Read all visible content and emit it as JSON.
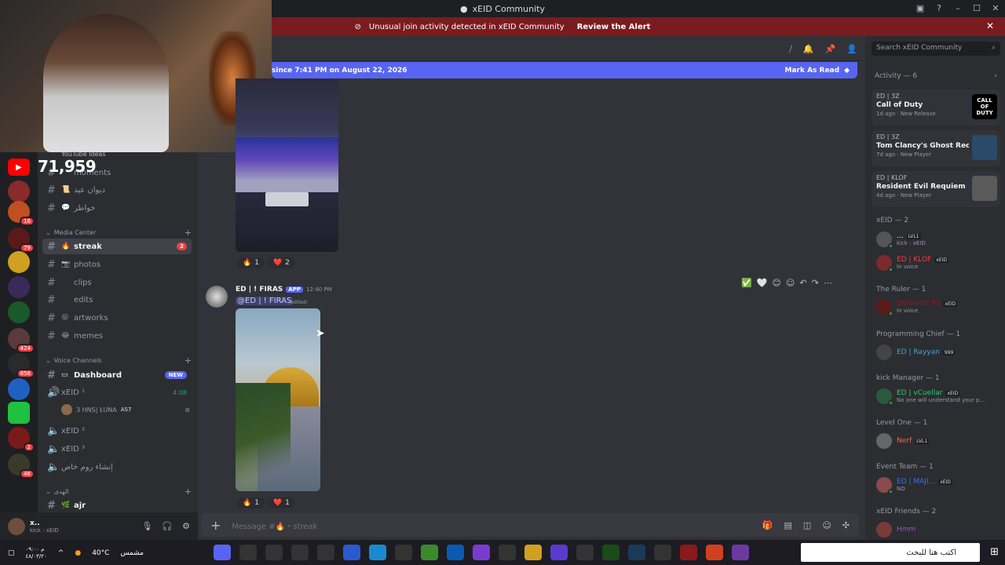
{
  "window": {
    "title": "xEID Community"
  },
  "alert": {
    "text": "Unusual join activity detected in xEID Community",
    "action": "Review the Alert"
  },
  "stream_overlay": {
    "label": "YouTube Ideas",
    "count": "71,959"
  },
  "channels": {
    "items_top": [
      {
        "emoji": "",
        "label": "moments"
      },
      {
        "emoji": "📜",
        "label": "ديوان عيد"
      },
      {
        "emoji": "💬",
        "label": "خواطر"
      }
    ],
    "media_category": "Media Center",
    "media_items": [
      {
        "emoji": "🔥",
        "label": "streak",
        "badge": "2",
        "active": true
      },
      {
        "emoji": "📷",
        "label": "photos"
      },
      {
        "emoji": "",
        "label": "clips"
      },
      {
        "emoji": "",
        "label": "edits"
      },
      {
        "emoji": "😝",
        "label": "artworks"
      },
      {
        "emoji": "😂",
        "label": "memes"
      }
    ],
    "voice_category": "Voice Channels",
    "dashboard": {
      "label": "Dashboard",
      "tag": "NEW"
    },
    "voice_items": [
      {
        "label": "xEID ¹",
        "time": "4:08"
      },
      {
        "label": "xEID ²"
      },
      {
        "label": "xEID ³"
      },
      {
        "label": "إنشاء روم خاص"
      }
    ],
    "voice_user": {
      "name": "3 HNS| ŁUNA",
      "tag": "AS7"
    },
    "bottom_category": "الهدى",
    "bottom_item": "ajr"
  },
  "user_panel": {
    "name": "x..",
    "status": "kick : xEID"
  },
  "new_messages_bar": {
    "text": "since 7:41 PM on August 22, 2026",
    "action": "Mark As Read"
  },
  "message1": {
    "reactions": [
      {
        "emoji": "🔥",
        "count": "1"
      },
      {
        "emoji": "❤️",
        "count": "2"
      }
    ]
  },
  "message2": {
    "author": "ED | ! FIRAS",
    "tag": "APP",
    "time": "12:40 PM",
    "mention": "@ED | ! FIRAS",
    "edited": "(edited)",
    "reactions": [
      {
        "emoji": "🔥",
        "count": "1"
      },
      {
        "emoji": "❤️",
        "count": "1"
      }
    ]
  },
  "composer": {
    "placeholder": "Message #🔥・streak"
  },
  "right": {
    "search_placeholder": "Search xEID Community",
    "activity_header": "Activity — 6",
    "activities": [
      {
        "who": "ED | 3Z",
        "game": "Call of Duty",
        "meta": "1d ago · New Release",
        "thumb": "CALL OF DUTY"
      },
      {
        "who": "ED | 3Z",
        "game": "Tom Clancy's Ghost Recon ...",
        "meta": "7d ago · New Player",
        "thumb": ""
      },
      {
        "who": "ED | KLOF",
        "game": "Resident Evil Requiem",
        "meta": "4d ago · New Player",
        "thumb": ""
      }
    ],
    "groups": [
      {
        "title": "xEID — 2",
        "members": [
          {
            "name": "...",
            "tag": "LVL1",
            "status": "kick : xEID",
            "color": "#f2f3f5"
          },
          {
            "name": "ED | KLOF",
            "tag": "xEID",
            "status": "In voice",
            "color": "#f23f43"
          }
        ]
      },
      {
        "title": "The Ruler — 1",
        "members": [
          {
            "name": "ENNAMIE PS",
            "tag": "xEID",
            "status": "In voice",
            "color": "#8a1c1c"
          }
        ]
      },
      {
        "title": "Programming Chief — 1",
        "members": [
          {
            "name": "ED | Rayyan",
            "tag": "999",
            "status": "",
            "color": "#3ba8e0"
          }
        ]
      },
      {
        "title": "kick Manager — 1",
        "members": [
          {
            "name": "ED | vCuellar",
            "tag": "xEID",
            "status": "No one will understand your p...",
            "color": "#2ecc71"
          }
        ]
      },
      {
        "title": "Level One — 1",
        "members": [
          {
            "name": "Nerf",
            "tag": "LVL1",
            "status": "",
            "color": "#f26b3a"
          }
        ]
      },
      {
        "title": "Event Team — 1",
        "members": [
          {
            "name": "ED | MAJI...",
            "tag": "xEID",
            "status": "NO",
            "color": "#3b6ef2"
          }
        ]
      },
      {
        "title": "xEID Friends — 2",
        "members": [
          {
            "name": "Hmm",
            "tag": "",
            "status": "",
            "color": "#9b59b6"
          }
        ]
      }
    ]
  },
  "taskbar": {
    "time": "م ٠٩:٠٠",
    "date": "٤٨/٠٣/٢٠",
    "weather": "40°C",
    "weather_label": "مشمس",
    "search_placeholder": "اكتب هنا للبحث"
  },
  "colors": {
    "accent": "#5865f2",
    "alert": "#7a1c1f",
    "danger": "#f23f43"
  }
}
